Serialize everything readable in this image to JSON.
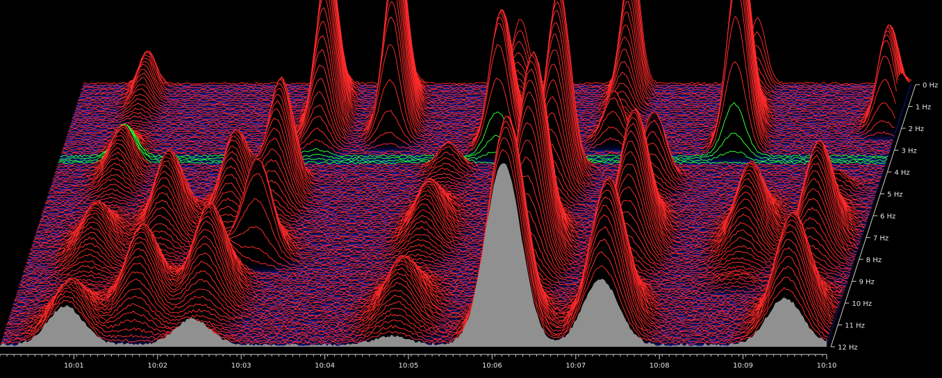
{
  "chart_data": {
    "type": "waterfall",
    "title": "",
    "xlabel": "",
    "ylabel": "",
    "x_ticks": [
      "10:01",
      "10:02",
      "10:03",
      "10:04",
      "10:05",
      "10:06",
      "10:07",
      "10:08",
      "10:09",
      "10:10"
    ],
    "y_ticks": [
      "0 Hz",
      "1 Hz",
      "2 Hz",
      "3 Hz",
      "4 Hz",
      "5 Hz",
      "6 Hz",
      "7 Hz",
      "8 Hz",
      "9 Hz",
      "10 Hz",
      "11 Hz",
      "12 Hz"
    ],
    "x_range": [
      "10:00:07",
      "10:10:00"
    ],
    "y_range": [
      0,
      12
    ],
    "colors": {
      "background": "#000000",
      "plane": "#0d1a8c",
      "low": "#1533ff",
      "mid": "#30ffe0",
      "high": "#30ff30",
      "peak": "#ff2a2a",
      "front_fill": "#909090",
      "axis": "#cfcfcf"
    },
    "events": [
      {
        "t": "10:00:54",
        "f0": 0.2,
        "f1": 12.0,
        "amp": 0.55
      },
      {
        "t": "10:01:40",
        "f0": 5.8,
        "f1": 11.5,
        "amp": 0.9
      },
      {
        "t": "10:02:25",
        "f0": 5.5,
        "f1": 12.0,
        "amp": 1.0
      },
      {
        "t": "10:02:52",
        "f0": 4.5,
        "f1": 8.0,
        "amp": 1.4
      },
      {
        "t": "10:03:10",
        "f0": 0.1,
        "f1": 3.0,
        "amp": 2.2
      },
      {
        "t": "10:04:00",
        "f0": 0.0,
        "f1": 2.5,
        "amp": 2.5
      },
      {
        "t": "10:04:48",
        "f0": 4.0,
        "f1": 12.0,
        "amp": 0.6
      },
      {
        "t": "10:05:20",
        "f0": 0.0,
        "f1": 3.0,
        "amp": 1.8
      },
      {
        "t": "10:06:08",
        "f0": 4.0,
        "f1": 12.0,
        "amp": 2.4
      },
      {
        "t": "10:06:40",
        "f0": 0.0,
        "f1": 2.5,
        "amp": 1.9
      },
      {
        "t": "10:07:18",
        "f0": 4.5,
        "f1": 12.0,
        "amp": 1.6
      },
      {
        "t": "10:08:10",
        "f0": 0.0,
        "f1": 3.0,
        "amp": 2.6
      },
      {
        "t": "10:08:40",
        "f0": 5.5,
        "f1": 9.0,
        "amp": 0.9
      },
      {
        "t": "10:09:30",
        "f0": 5.0,
        "f1": 12.0,
        "amp": 1.2
      },
      {
        "t": "10:09:52",
        "f0": 0.0,
        "f1": 2.0,
        "amp": 1.3
      }
    ]
  }
}
